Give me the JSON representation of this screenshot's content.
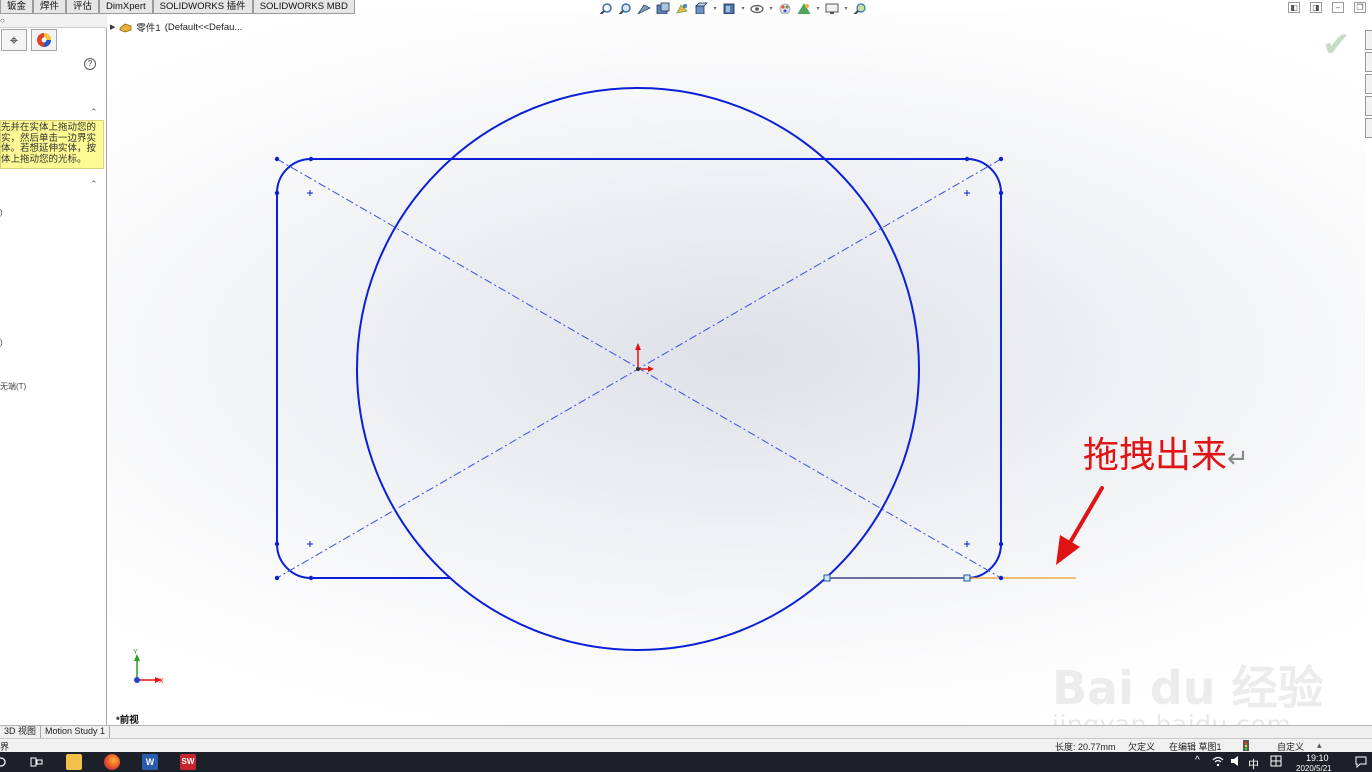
{
  "command_tabs": [
    "钣金",
    "焊件",
    "评估",
    "DimXpert",
    "SOLIDWORKS 插件",
    "SOLIDWORKS MBD"
  ],
  "left_panel": {
    "tip_lines": [
      "先并在实体上拖动您的",
      "实，然后单击一边界实",
      "体。若想延伸实体，按",
      "体上拖动您的光标。"
    ],
    "help_glyph": "?",
    "fragments": [
      ")",
      ")",
      "无端(T)"
    ]
  },
  "breadcrumb": {
    "part_name": "零件1",
    "config": "(Default<<Defau..."
  },
  "view_name": "*前视",
  "annotation": {
    "text": "拖拽出来",
    "return_mark": "↵",
    "color": "#e01414"
  },
  "triad": {
    "x_label": "X",
    "y_label": "Y"
  },
  "bottom_tabs": [
    "3D 视图",
    "Motion Study 1"
  ],
  "status_bar": {
    "left": "界",
    "length": "长度: 20.77mm",
    "state": "欠定义",
    "editing": "在编辑 草图1",
    "units": "自定义"
  },
  "taskbar": {
    "word_label": "W",
    "sw_label": "SW",
    "ime_label": "中",
    "time": "19:10",
    "date": "2020/5/21"
  },
  "watermark": {
    "title": "Bai du 经验",
    "subtitle": "jingyan.baidu.com"
  },
  "colors": {
    "sketch_blue": "#0a1fd6",
    "highlight_orange": "#f29a2e",
    "arrow_red": "#e01414",
    "tip_yellow": "#fdf993"
  }
}
